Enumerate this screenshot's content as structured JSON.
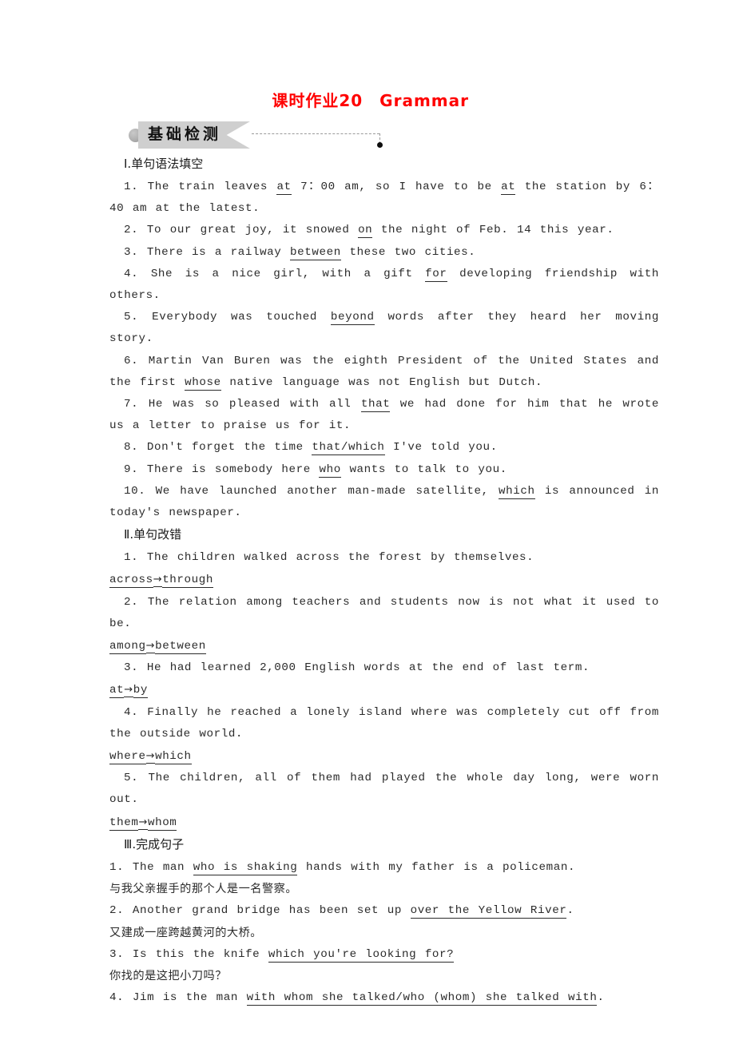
{
  "document": {
    "title": "课时作业20　Grammar",
    "title_color": "#ff0000",
    "banner": {
      "label": "基础检测",
      "bg_color": "#cfcfcf",
      "dot_icon": "gray-bullet-icon",
      "end_dot_icon": "black-dot-icon"
    }
  },
  "sections": [
    {
      "heading": "Ⅰ.单句语法填空",
      "items": [
        {
          "num": "1.",
          "pre": "The train leaves ",
          "answer": "at",
          "post": " 7：00 am, so I have to be ",
          "answer2": "at",
          "post2": " the station by 6：40 am at the latest."
        },
        {
          "num": "2.",
          "pre": "To our great joy, it snowed ",
          "answer": "on",
          "post": " the night of Feb. 14 this year."
        },
        {
          "num": "3.",
          "pre": "There is a railway ",
          "answer": "between",
          "post": " these two cities."
        },
        {
          "num": "4.",
          "pre": "She is a nice girl, with a gift ",
          "answer": "for",
          "post": " developing friendship with others."
        },
        {
          "num": "5.",
          "pre": "Everybody was touched ",
          "answer": "beyond",
          "post": " words after they heard her moving story."
        },
        {
          "num": "6.",
          "pre": "Martin Van Buren was the eighth President of the United States and the first ",
          "answer": "whose",
          "post": " native language was not English but Dutch."
        },
        {
          "num": "7.",
          "pre": "He was so pleased with all ",
          "answer": "that",
          "post": " we had done for him that he wrote us a letter to praise us for it."
        },
        {
          "num": "8.",
          "pre": "Don't forget the time ",
          "answer": "that/which",
          "post": " I've told you."
        },
        {
          "num": "9.",
          "pre": "There is somebody here ",
          "answer": "who",
          "post": " wants to talk to you."
        },
        {
          "num": "10.",
          "pre": "We have launched another man-made satellite, ",
          "answer": "which",
          "post": " is announced in today's newspaper."
        }
      ]
    },
    {
      "heading": "Ⅱ.单句改错",
      "items": [
        {
          "num": "1.",
          "sentence": "The children walked across the forest by themselves.",
          "correction_from": "across",
          "correction_to": "through"
        },
        {
          "num": "2.",
          "sentence": "The relation among teachers and students now is not what it used to be.",
          "correction_from": "among",
          "correction_to": "between"
        },
        {
          "num": "3.",
          "sentence": "He had learned 2,000 English words at the end of last term.",
          "correction_from": "at",
          "correction_to": "by"
        },
        {
          "num": "4.",
          "sentence": "Finally he reached a lonely island where was completely cut off from the outside world.",
          "correction_from": "where",
          "correction_to": "which"
        },
        {
          "num": "5.",
          "sentence": "The children, all of them had played the whole day long, were worn out.",
          "correction_from": "them",
          "correction_to": "whom"
        }
      ],
      "arrow_glyph": "→"
    },
    {
      "heading": "Ⅲ.完成句子",
      "items": [
        {
          "num": "1.",
          "pre": "The man ",
          "answer": "who is shaking",
          "post": " hands with my father is a policeman.",
          "translation": "与我父亲握手的那个人是一名警察。"
        },
        {
          "num": "2.",
          "pre": "Another grand bridge has been set up ",
          "answer": "over the Yellow River",
          "post": ".",
          "translation": "又建成一座跨越黄河的大桥。"
        },
        {
          "num": "3.",
          "pre": "Is this the knife ",
          "answer": "which you're looking for?",
          "post": "",
          "translation": "你找的是这把小刀吗？"
        },
        {
          "num": "4.",
          "pre": "Jim is the man ",
          "answer": "with whom she talked/who (whom) she talked with",
          "post": ".",
          "translation": ""
        }
      ]
    }
  ]
}
